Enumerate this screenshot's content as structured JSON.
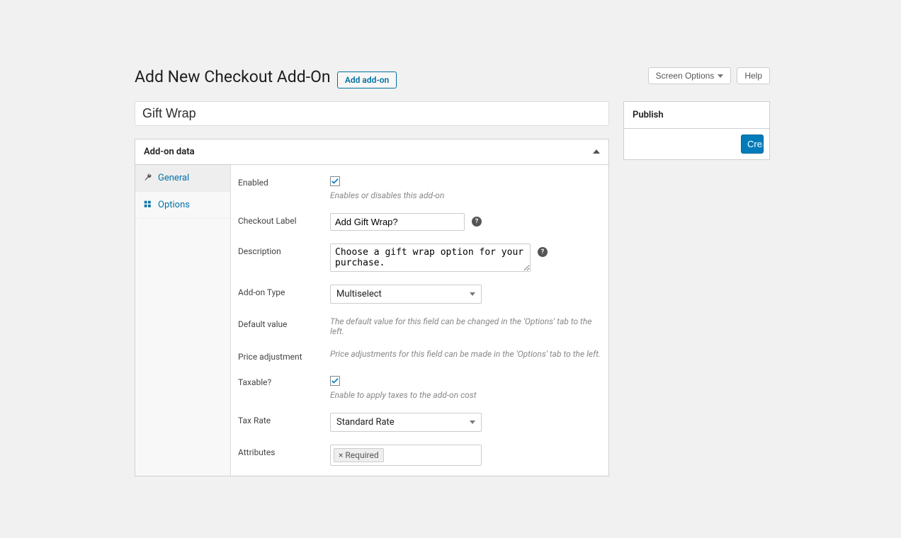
{
  "topbar": {
    "screen_options": "Screen Options",
    "help": "Help"
  },
  "header": {
    "title": "Add New Checkout Add-On",
    "add_button": "Add add-on"
  },
  "title_input": {
    "value": "Gift Wrap"
  },
  "panel": {
    "title": "Add-on data",
    "tabs": {
      "general": "General",
      "options": "Options"
    }
  },
  "form": {
    "enabled": {
      "label": "Enabled",
      "checked": true,
      "hint": "Enables or disables this add-on"
    },
    "checkout_label": {
      "label": "Checkout Label",
      "value": "Add Gift Wrap?"
    },
    "description": {
      "label": "Description",
      "value": "Choose a gift wrap option for your purchase."
    },
    "addon_type": {
      "label": "Add-on Type",
      "value": "Multiselect"
    },
    "default_value": {
      "label": "Default value",
      "hint": "The default value for this field can be changed in the 'Options' tab to the left."
    },
    "price_adjustment": {
      "label": "Price adjustment",
      "hint": "Price adjustments for this field can be made in the 'Options' tab to the left."
    },
    "taxable": {
      "label": "Taxable?",
      "checked": true,
      "hint": "Enable to apply taxes to the add-on cost"
    },
    "tax_rate": {
      "label": "Tax Rate",
      "value": "Standard Rate"
    },
    "attributes": {
      "label": "Attributes",
      "tag": "Required"
    }
  },
  "publish": {
    "title": "Publish",
    "button": "Create"
  }
}
